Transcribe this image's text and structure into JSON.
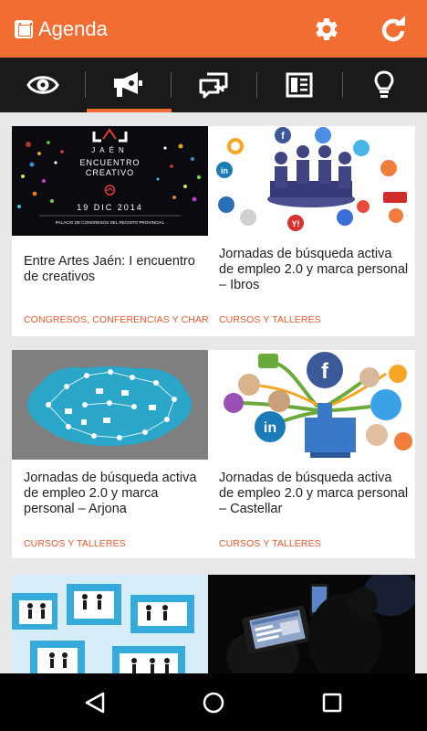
{
  "app": {
    "title": "Agenda",
    "accent": "#f16d31"
  },
  "appbar": {
    "settings_icon": "gear-icon",
    "refresh_icon": "refresh-icon"
  },
  "tabs": [
    {
      "icon": "eye-icon",
      "selected": false
    },
    {
      "icon": "megaphone-icon",
      "selected": true
    },
    {
      "icon": "chat-bubbles-icon",
      "selected": false
    },
    {
      "icon": "news-icon",
      "selected": false
    },
    {
      "icon": "lightbulb-icon",
      "selected": false
    }
  ],
  "cards": [
    {
      "title": "Entre Artes Jaén: I encuentro de creativos",
      "category": "CONGRESOS, CONFERENCIAS Y CHARLAS",
      "image": {
        "brand": "JAÉN",
        "line1": "ENCUENTRO",
        "line2": "CREATIVO",
        "date": "19 DIC 2014",
        "venue": "PALACIO DE CONGRESOS DEL RECINTO PROVINCIAL"
      }
    },
    {
      "title": "Jornadas de búsqueda activa de empleo 2.0 y marca personal – Ibros",
      "category": "CURSOS Y TALLERES"
    },
    {
      "title": "Jornadas de búsqueda activa de empleo 2.0 y marca personal – Arjona",
      "category": "CURSOS Y TALLERES"
    },
    {
      "title": "Jornadas de búsqueda activa de empleo 2.0 y marca personal – Castellar",
      "category": "CURSOS Y TALLERES"
    },
    {
      "title": "",
      "category": ""
    },
    {
      "title": "",
      "category": ""
    }
  ],
  "navbar": {
    "back_icon": "back-icon",
    "home_icon": "home-icon",
    "recents_icon": "recents-icon"
  }
}
